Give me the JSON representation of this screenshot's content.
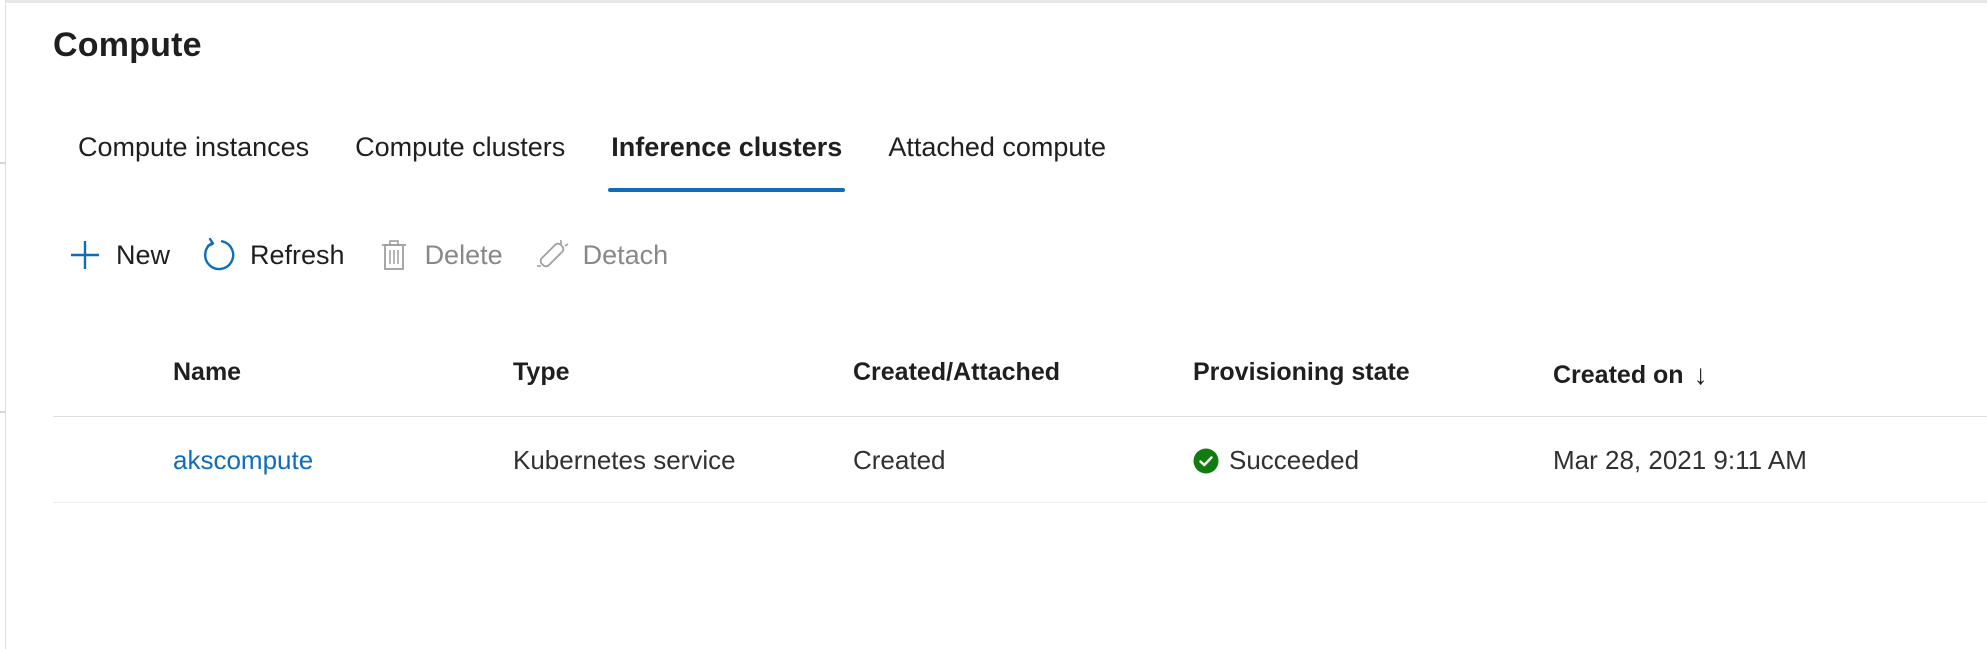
{
  "page": {
    "title": "Compute"
  },
  "tabs": [
    {
      "label": "Compute instances",
      "active": false
    },
    {
      "label": "Compute clusters",
      "active": false
    },
    {
      "label": "Inference clusters",
      "active": true
    },
    {
      "label": "Attached compute",
      "active": false
    }
  ],
  "toolbar": {
    "new_label": "New",
    "new_icon": "plus-icon",
    "refresh_label": "Refresh",
    "refresh_icon": "refresh-icon",
    "delete_label": "Delete",
    "delete_icon": "trash-icon",
    "delete_disabled": true,
    "detach_label": "Detach",
    "detach_icon": "unlink-icon",
    "detach_disabled": true
  },
  "table": {
    "columns": [
      {
        "label": "Name"
      },
      {
        "label": "Type"
      },
      {
        "label": "Created/Attached"
      },
      {
        "label": "Provisioning state"
      },
      {
        "label": "Created on",
        "sort": "↓"
      }
    ],
    "rows": [
      {
        "name": "akscompute",
        "type": "Kubernetes service",
        "created_attached": "Created",
        "provisioning_state": "Succeeded",
        "provisioning_icon": "check-circle-icon",
        "created_on": "Mar 28, 2021 9:11 AM"
      }
    ]
  },
  "colors": {
    "accent": "#0f6cbd",
    "success": "#107c10",
    "disabled_text": "#8a8886",
    "text": "#201f1e"
  }
}
